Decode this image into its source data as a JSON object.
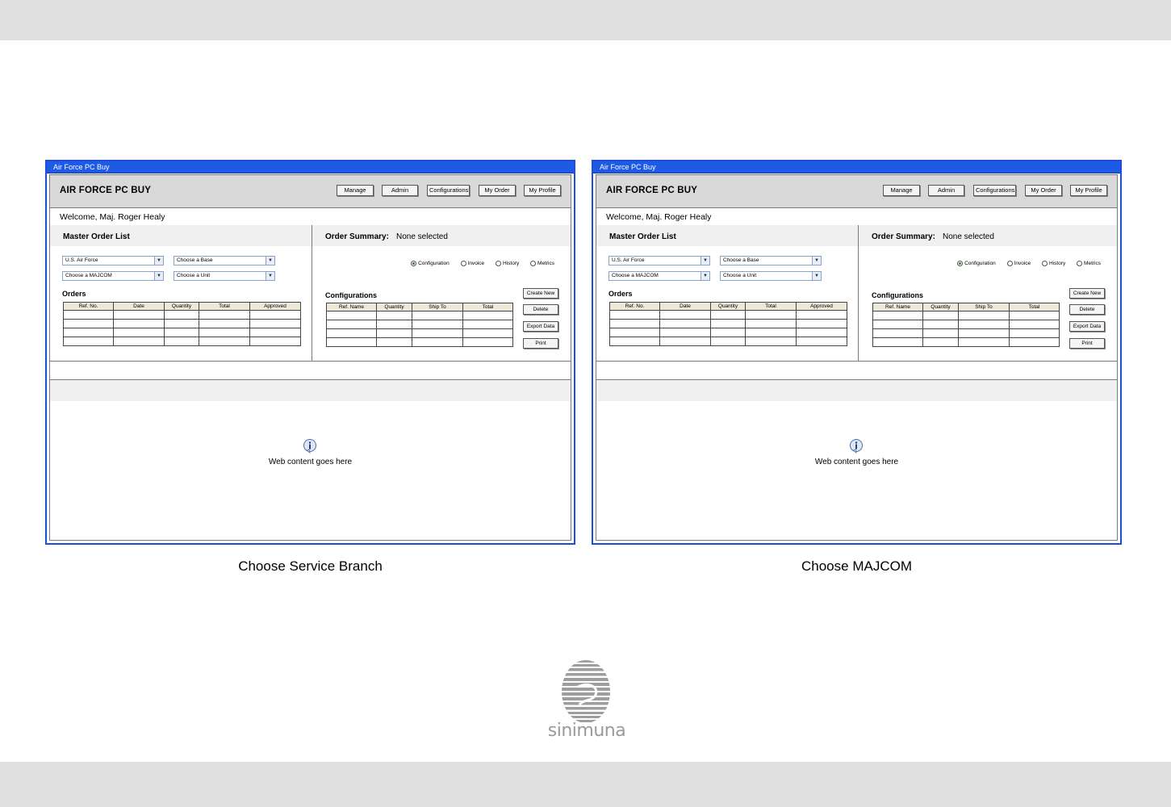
{
  "windows": [
    {
      "title_bar": "Air Force PC Buy",
      "app_title": "AIR FORCE PC BUY",
      "nav": [
        "Manage",
        "Admin",
        "Configurations",
        "My Order",
        "My Profile"
      ],
      "welcome": "Welcome, Maj. Roger Healy",
      "master_title": "Master Order List",
      "selects": [
        "U.S. Air Force",
        "Choose a Base",
        "Choose a MAJCOM",
        "Choose a Unit"
      ],
      "orders_label": "Orders",
      "orders_columns": [
        "Ref. No.",
        "Date",
        "Quantity",
        "Total",
        "Approved"
      ],
      "summary_label": "Order Summary:",
      "summary_value": "None selected",
      "radios": [
        "Configuration",
        "Invoice",
        "History",
        "Metrics"
      ],
      "radio_selected": "Configuration",
      "configs_label": "Configurations",
      "configs_columns": [
        "Ref. Name",
        "Quantity",
        "Ship To",
        "Total"
      ],
      "actions": [
        "Create New",
        "Delete",
        "Export Data",
        "Print"
      ],
      "web_content": "Web content goes here",
      "caption": "Choose Service Branch"
    },
    {
      "title_bar": "Air Force PC Buy",
      "app_title": "AIR FORCE PC BUY",
      "nav": [
        "Manage",
        "Admin",
        "Configurations",
        "My Order",
        "My Profile"
      ],
      "welcome": "Welcome, Maj. Roger Healy",
      "master_title": "Master Order List",
      "selects": [
        "U.S. Air Force",
        "Choose a Base",
        "Choose a MAJCOM",
        "Choose a Unit"
      ],
      "orders_label": "Orders",
      "orders_columns": [
        "Ref. No.",
        "Date",
        "Quantity",
        "Total",
        "Approved"
      ],
      "summary_label": "Order Summary:",
      "summary_value": "None selected",
      "radios": [
        "Configuration",
        "Invoice",
        "History",
        "Metrics"
      ],
      "radio_selected": "Configuration",
      "configs_label": "Configurations",
      "configs_columns": [
        "Ref. Name",
        "Quantity",
        "Ship To",
        "Total"
      ],
      "actions": [
        "Create New",
        "Delete",
        "Export Data",
        "Print"
      ],
      "web_content": "Web content goes here",
      "caption": "Choose MAJCOM"
    }
  ],
  "logo": {
    "text": "sinimuna",
    "icon": "striped-globe-icon"
  },
  "colors": {
    "window_border": "#1c4fd8",
    "title_bar": "#1e5ae6",
    "header_bg": "#d9d9d9",
    "band": "#e0e0e0"
  }
}
